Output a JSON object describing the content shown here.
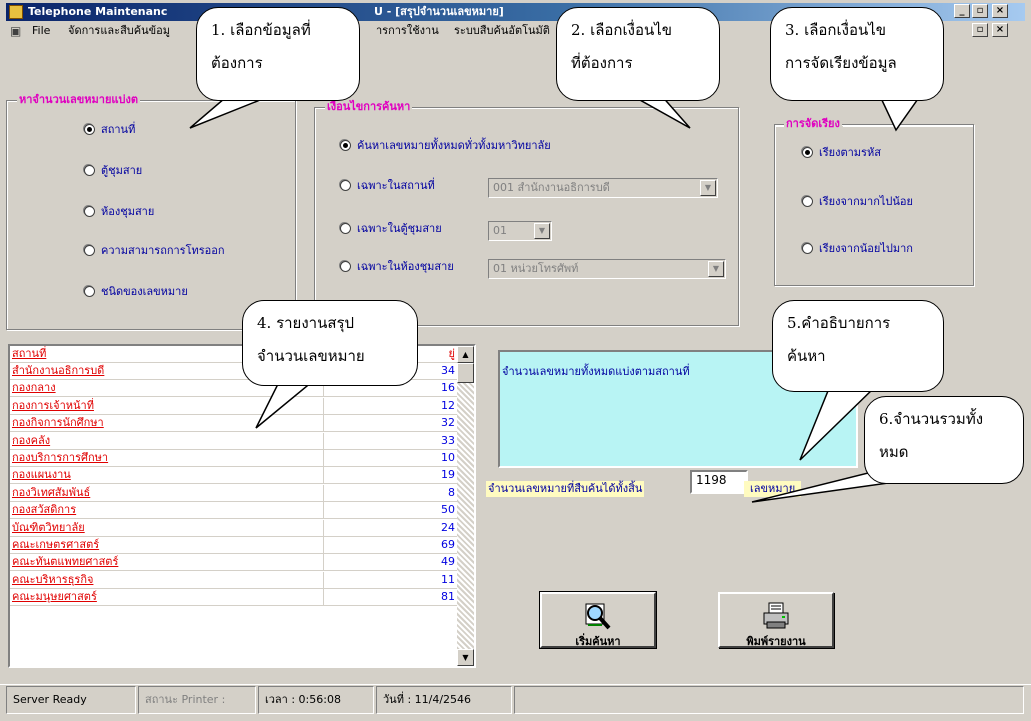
{
  "window": {
    "title_app": "Telephone Maintenanc",
    "title_tail": "U - [สรุปจำนวนเลขหมาย]",
    "min_glyph": "_",
    "restore_glyph": "▫",
    "close_glyph": "×"
  },
  "menu": {
    "items": [
      "File",
      "จัดการและสืบค้นข้อมู",
      "ารการใช้งาน",
      "ระบบสืบค้นอัตโนมัติ"
    ],
    "doc_glyph": "▣"
  },
  "group_by": {
    "title": "หาจำนวนเลขหมายแบ่งต",
    "options": [
      "สถานที่",
      "ตู้ชุมสาย",
      "ห้องชุมสาย",
      "ความสามารถการโทรออก",
      "ชนิดของเลขหมาย"
    ],
    "selected_index": 0
  },
  "conditions": {
    "title": "เงื่อนไขการค้นหา",
    "options": [
      "ค้นหาเลขหมายทั้งหมดทั่วทั้งมหาวิทยาลัย",
      "เฉพาะในสถานที่",
      "เฉพาะในตู้ชุมสาย",
      "เฉพาะในห้องชุมสาย"
    ],
    "selected_index": 0,
    "combo_place": "001 สำนักงานอธิการบดี",
    "combo_cabinet": "01",
    "combo_room": "01 หน่วยโทรศัพท์"
  },
  "sorting": {
    "title": "การจัดเรียง",
    "options": [
      "เรียงตามรหัส",
      "เรียงจากมากไปน้อย",
      "เรียงจากน้อยไปมาก"
    ],
    "selected_index": 0
  },
  "report": {
    "col1_header": "สถานที่",
    "col2_header": "ยู่",
    "rows": [
      {
        "name": "สำนักงานอธิการบดี",
        "count": "34"
      },
      {
        "name": "กองกลาง",
        "count": "16"
      },
      {
        "name": "กองการเจ้าหน้าที่",
        "count": "12"
      },
      {
        "name": "กองกิจการนักศึกษา",
        "count": "32"
      },
      {
        "name": "กองคลัง",
        "count": "33"
      },
      {
        "name": "กองบริการการศึกษา",
        "count": "10"
      },
      {
        "name": "กองแผนงาน",
        "count": "19"
      },
      {
        "name": "กองวิเทศสัมพันธ์",
        "count": "8"
      },
      {
        "name": "กองสวัสดิการ",
        "count": "50"
      },
      {
        "name": "บัณฑิตวิทยาลัย",
        "count": "24"
      },
      {
        "name": "คณะเกษตรศาสตร์",
        "count": "69"
      },
      {
        "name": "คณะทันตแพทยศาสตร์",
        "count": "49"
      },
      {
        "name": "คณะบริหารธุรกิจ",
        "count": "11"
      },
      {
        "name": "คณะมนุษยศาสตร์",
        "count": "81"
      }
    ],
    "scroll_up_glyph": "▲",
    "scroll_down_glyph": "▼"
  },
  "description": {
    "text": "จำนวนเลขหมายทั้งหมดแบ่งตามสถานที่"
  },
  "total": {
    "label": "จำนวนเลขหมายที่สืบค้นได้ทั้งสิ้น",
    "value": "1198",
    "unit": "เลขหมาย"
  },
  "buttons": {
    "search": "เริ่มค้นหา",
    "print": "พิมพ์รายงาน"
  },
  "statusbar": {
    "server": "Server Ready",
    "printer": "สถานะ Printer :",
    "time": "เวลา : 0:56:08",
    "date": "วันที่ : 11/4/2546"
  },
  "callouts": {
    "c1_line1": "1. เลือกข้อมูลที่",
    "c1_line2": "ต้องการ",
    "c2_line1": "2. เลือกเงื่อนไข",
    "c2_line2": "ที่ต้องการ",
    "c3_line1": "3. เลือกเงื่อนไข",
    "c3_line2": "การจัดเรียงข้อมูล",
    "c4_line1": "4. รายงานสรุป",
    "c4_line2": "จำนวนเลขหมาย",
    "c5_line1": "5.คำอธิบายการ",
    "c5_line2": "ค้นหา",
    "c6_line1": "6.จำนวนรวมทั้ง",
    "c6_line2": "หมด"
  },
  "colors": {
    "title_bar": "#0a246a",
    "group_title": "#e000c0",
    "group_text": "#0000a0",
    "list_name": "#e00000",
    "list_count": "#0000e0",
    "description_bg": "#b8f4f4"
  }
}
